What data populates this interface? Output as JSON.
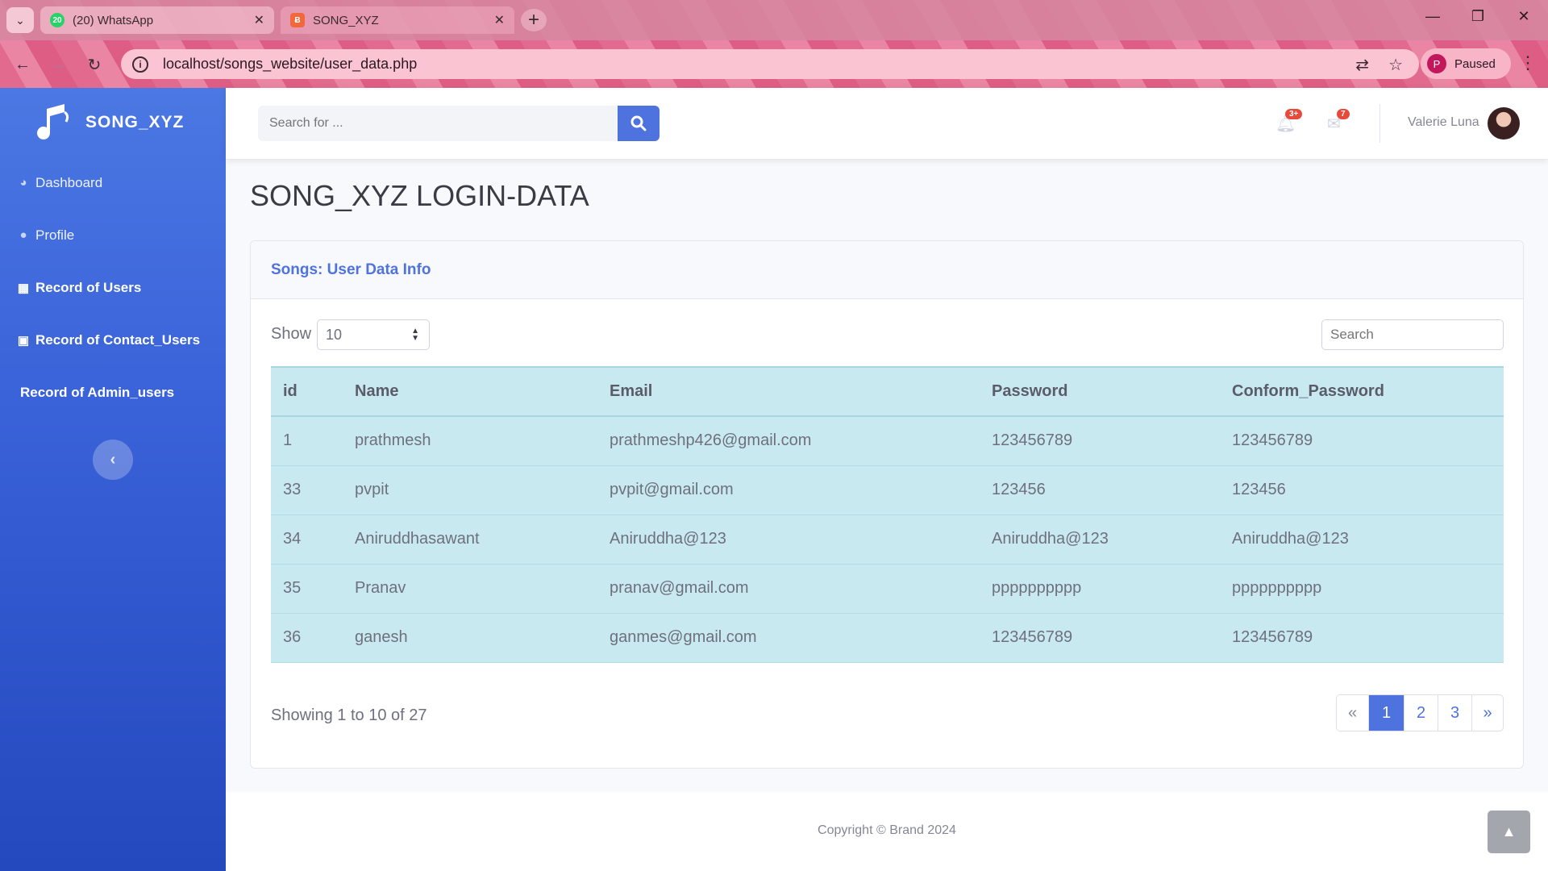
{
  "browser": {
    "tabs": [
      {
        "title": "(20) WhatsApp",
        "badge": "20",
        "icon": "whatsapp-icon"
      },
      {
        "title": "SONG_XYZ",
        "icon": "xampp-icon"
      }
    ],
    "url": "localhost/songs_website/user_data.php",
    "profile_initial": "P",
    "profile_status": "Paused"
  },
  "sidebar": {
    "brand": "SONG_XYZ",
    "items": [
      {
        "label": "Dashboard",
        "icon": "dashboard-icon"
      },
      {
        "label": "Profile",
        "icon": "user-icon"
      },
      {
        "label": "Record of Users",
        "icon": "table-icon"
      },
      {
        "label": "Record of Contact_Users",
        "icon": "contact-book-icon"
      },
      {
        "label": "Record of Admin_users",
        "icon": ""
      }
    ]
  },
  "topbar": {
    "search_placeholder": "Search for ...",
    "alerts_badge": "3+",
    "messages_badge": "7",
    "user_name": "Valerie Luna"
  },
  "main": {
    "page_title": "SONG_XYZ LOGIN-DATA",
    "card_title": "Songs: User Data Info",
    "show_label": "Show",
    "show_value": "10",
    "search_placeholder": "Search",
    "columns": [
      "id",
      "Name",
      "Email",
      "Password",
      "Conform_Password"
    ],
    "rows": [
      [
        "1",
        "prathmesh",
        "prathmeshp426@gmail.com",
        "123456789",
        "123456789"
      ],
      [
        "33",
        "pvpit",
        "pvpit@gmail.com",
        "123456",
        "123456"
      ],
      [
        "34",
        "Aniruddhasawant",
        "Aniruddha@123",
        "Aniruddha@123",
        "Aniruddha@123"
      ],
      [
        "35",
        "Pranav",
        "pranav@gmail.com",
        "pppppppppp",
        "pppppppppp"
      ],
      [
        "36",
        "ganesh",
        "ganmes@gmail.com",
        "123456789",
        "123456789"
      ]
    ],
    "showing_text": "Showing 1 to 10 of 27",
    "pagination": {
      "prev": "«",
      "pages": [
        "1",
        "2",
        "3"
      ],
      "next": "»"
    }
  },
  "footer": {
    "copyright": "Copyright © Brand 2024"
  },
  "colors": {
    "primary": "#4e73df",
    "table_bg": "#c9e9f1",
    "badge": "#e74a3b"
  }
}
